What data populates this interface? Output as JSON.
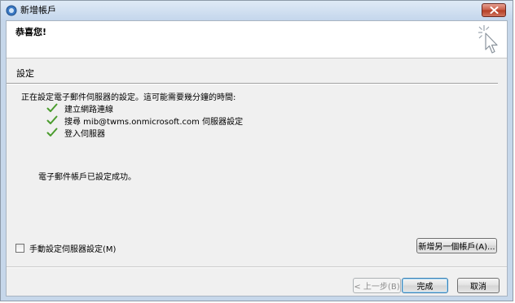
{
  "window": {
    "title": "新增帳戶"
  },
  "header": {
    "title": "恭喜您!"
  },
  "section": {
    "title": "設定",
    "intro": "正在設定電子郵件伺服器的設定。這可能需要幾分鐘的時間:",
    "steps": [
      {
        "label": "建立網路連線",
        "status": "done"
      },
      {
        "label": "搜尋 mib@twms.onmicrosoft.com 伺服器設定",
        "status": "done"
      },
      {
        "label": "登入伺服器",
        "status": "done"
      }
    ],
    "success_message": "電子郵件帳戶已設定成功。"
  },
  "options": {
    "manual_setup_label": "手動設定伺服器設定(M)",
    "manual_setup_checked": false,
    "add_another_label": "新增另一個帳戶(A)..."
  },
  "footer": {
    "back_label": "< 上一步(B)",
    "finish_label": "完成",
    "cancel_label": "取消"
  },
  "colors": {
    "check": "#4a9c2d",
    "close_button": "#c75a44",
    "titlebar": "#c4d6ec"
  }
}
